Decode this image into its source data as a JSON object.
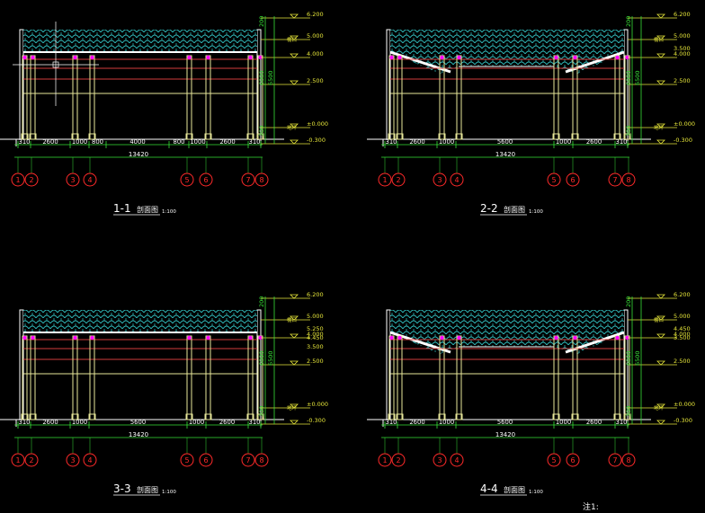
{
  "colors": {
    "background": "#000000",
    "wall": "#ffffff",
    "column": "#e8e89a",
    "beam_red": "#d23c3c",
    "roof_tile": "#2fb5b5",
    "roof_edge": "#ffffff",
    "dimension": "#37e037",
    "level": "#e6e63a",
    "level_label": "#e6e63a",
    "grid_circle": "#ff2a2a",
    "joint": "#ff00ff",
    "title": "#ffffff"
  },
  "common": {
    "levels": [
      "6.200",
      "5.000",
      "4.000",
      "2.500",
      "±0.000",
      "-0.300"
    ],
    "level_notes": {
      "eave_prefix": "檐口",
      "ground_prefix": "地坪"
    },
    "vertical_dims": [
      "200",
      "6000",
      "6500",
      "300"
    ],
    "grid_labels": [
      "1",
      "2",
      "3",
      "4",
      "5",
      "6",
      "7",
      "8"
    ],
    "total_dim": "13420"
  },
  "sections": [
    {
      "id": "s1",
      "title": "1-1",
      "title_suffix": "剖面图",
      "scale": "1:100",
      "dims": [
        "310",
        "2600",
        "1000",
        "800",
        "4000",
        "800",
        "1000",
        "2600",
        "310"
      ],
      "extra_levels": []
    },
    {
      "id": "s2",
      "title": "2-2",
      "title_suffix": "剖面图",
      "scale": "1:100",
      "dims": [
        "310",
        "2600",
        "1000",
        "5600",
        "1000",
        "2600",
        "310"
      ],
      "extra_levels": [
        "3.500"
      ]
    },
    {
      "id": "s3",
      "title": "3-3",
      "title_suffix": "剖面图",
      "scale": "1:100",
      "dims": [
        "310",
        "2600",
        "1000",
        "5600",
        "1000",
        "2600",
        "310"
      ],
      "extra_levels": [
        "5.250",
        "4.450",
        "3.500"
      ]
    },
    {
      "id": "s4",
      "title": "4-4",
      "title_suffix": "剖面图",
      "scale": "1:100",
      "dims": [
        "310",
        "2600",
        "1000",
        "5600",
        "1000",
        "2600",
        "310"
      ],
      "extra_levels": [
        "4.450",
        "3.500"
      ]
    }
  ],
  "note": "注1:"
}
